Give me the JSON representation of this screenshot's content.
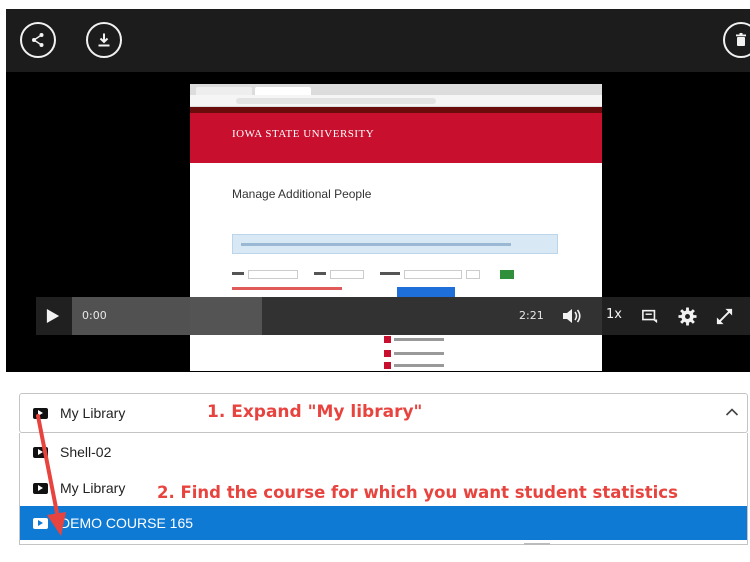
{
  "toolbar": {
    "share_icon": "share-icon",
    "download_icon": "download-icon",
    "delete_icon": "trash-icon"
  },
  "video_preview": {
    "university_name": "IOWA STATE UNIVERSITY",
    "page_title": "Manage Additional People"
  },
  "player": {
    "current_time": "0:00",
    "duration": "2:21",
    "speed": "1x",
    "icons": [
      "play-icon",
      "volume-icon",
      "captions-icon",
      "gear-icon",
      "fullscreen-icon"
    ]
  },
  "library": {
    "selected_label": "My Library",
    "items": [
      {
        "label": "Shell-02"
      },
      {
        "label": "My Library"
      },
      {
        "label": "DEMO COURSE 165",
        "selected": true
      }
    ]
  },
  "annotations": {
    "step1": "1. Expand \"My library\"",
    "step2": "2. Find the course for which you want student statistics",
    "arrow_color": "#e8443f"
  },
  "colors": {
    "selection_blue": "#0e7ad4",
    "isu_red": "#c8102e",
    "annotation_red": "#e8443f"
  }
}
